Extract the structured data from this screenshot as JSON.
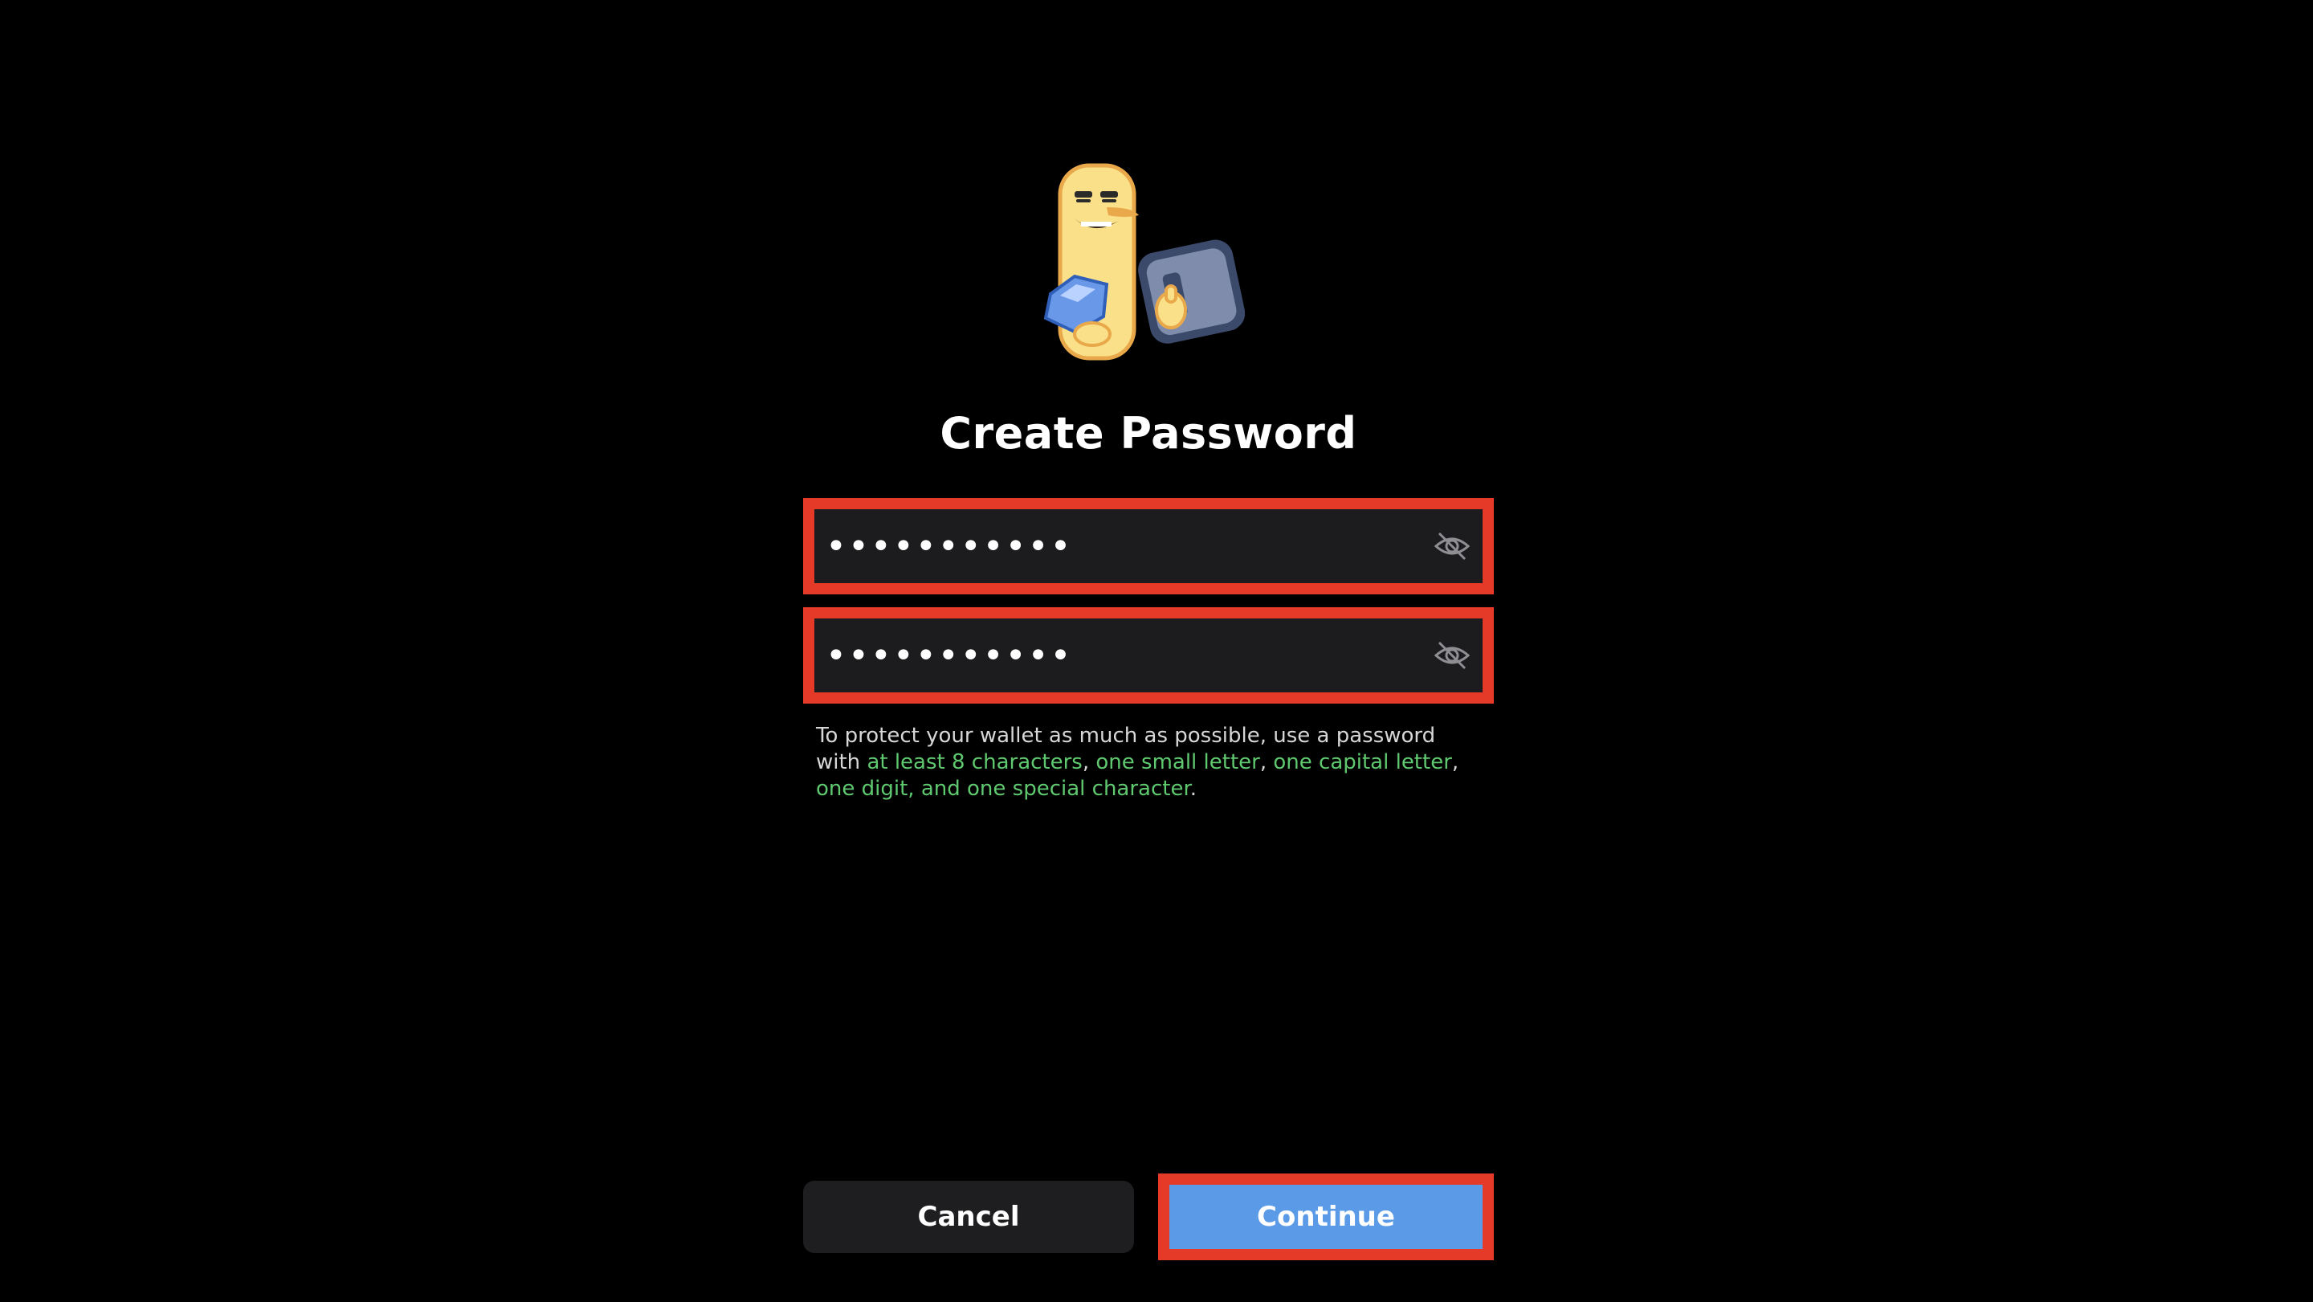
{
  "title": "Create Password",
  "password_field": {
    "value": "•••••••••••",
    "toggle_icon": "eye-off-icon"
  },
  "confirm_field": {
    "value": "•••••••••••",
    "toggle_icon": "eye-off-icon"
  },
  "hint": {
    "prefix": "To protect your wallet as much as possible, use a password with ",
    "req_length": "at least 8 characters",
    "sep1": ", ",
    "req_lower": "one small letter",
    "sep2": ", ",
    "req_upper": "one capital letter",
    "sep3": ", ",
    "req_digit": "one digit",
    "sep4": ", and ",
    "req_special": "one special character",
    "suffix": "."
  },
  "buttons": {
    "cancel": "Cancel",
    "continue": "Continue"
  },
  "colors": {
    "background": "#000000",
    "field_bg": "#1c1c1e",
    "highlight_border": "#e53a28",
    "primary_button": "#5a9ae6",
    "requirement_met": "#5fc96f"
  }
}
